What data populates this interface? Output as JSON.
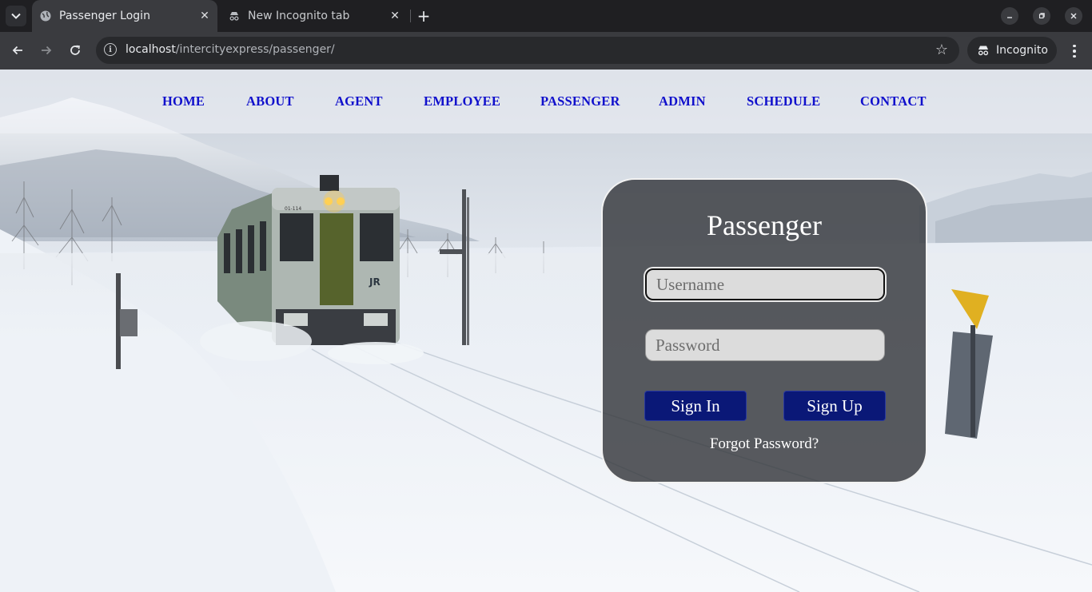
{
  "browser": {
    "tabs": [
      {
        "title": "Passenger Login",
        "active": true
      },
      {
        "title": "New Incognito tab",
        "active": false
      }
    ],
    "url_host": "localhost",
    "url_path": "/intercityexpress/passenger/",
    "profile_label": "Incognito"
  },
  "nav": {
    "items": [
      "HOME",
      "ABOUT",
      "AGENT",
      "EMPLOYEE",
      "PASSENGER",
      "ADMIN",
      "SCHEDULE",
      "CONTACT"
    ],
    "color": "#1010cc"
  },
  "login": {
    "title": "Passenger",
    "username_placeholder": "Username",
    "password_placeholder": "Password",
    "sign_in_label": "Sign In",
    "sign_up_label": "Sign Up",
    "forgot_label": "Forgot Password?",
    "button_color": "#0a1877"
  },
  "background": {
    "train_logo": "JR",
    "train_number": "01-114"
  }
}
